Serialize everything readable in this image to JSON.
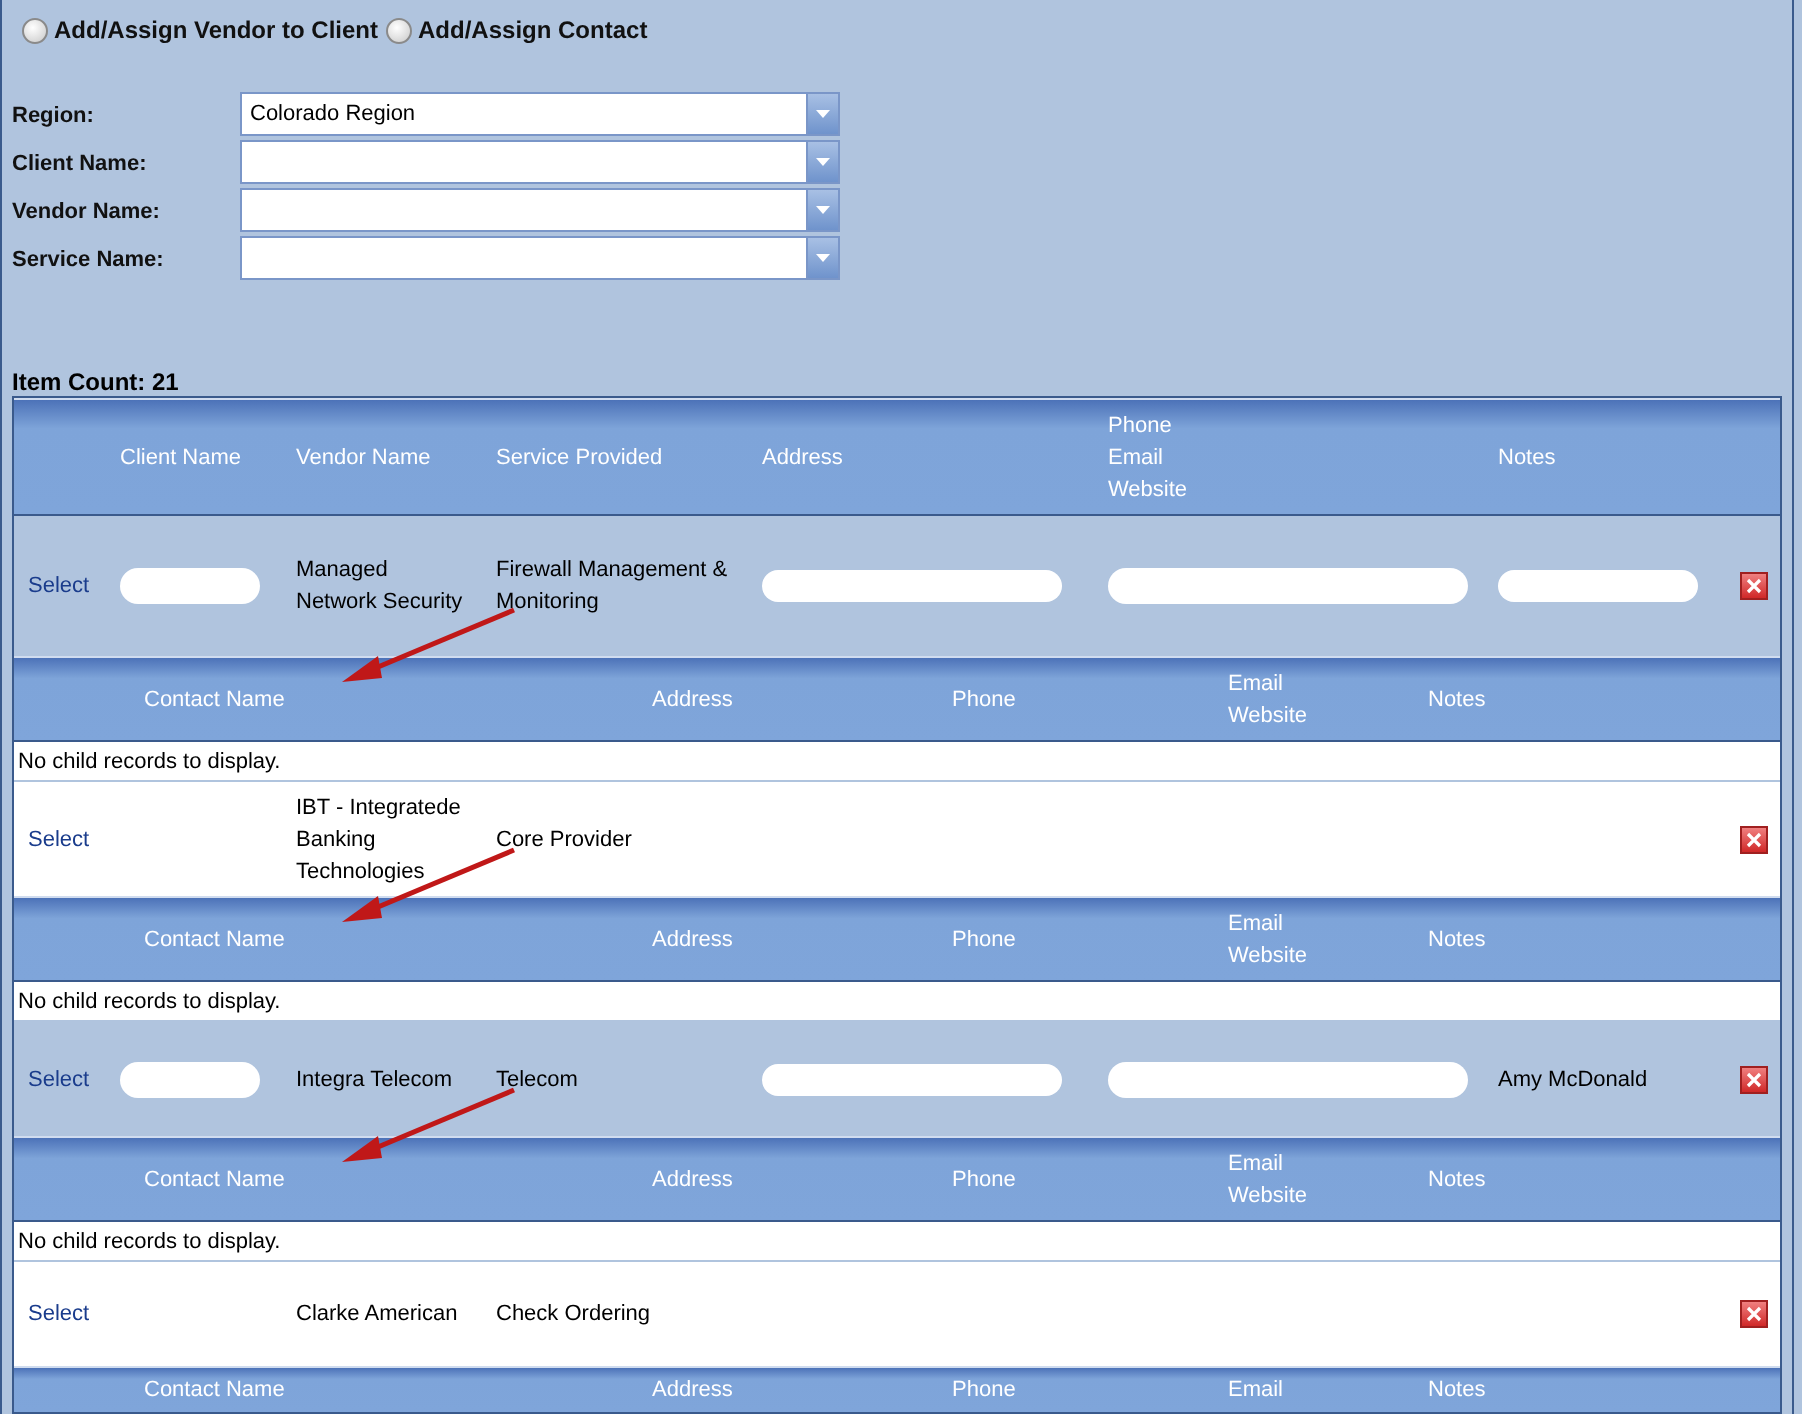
{
  "options": [
    {
      "label": "Add/Assign Vendor to Client",
      "selected": false
    },
    {
      "label": "Add/Assign Contact",
      "selected": false
    }
  ],
  "filters": [
    {
      "label": "Region:",
      "value": "Colorado Region"
    },
    {
      "label": "Client Name:"
    },
    {
      "label": "Vendor Name:"
    },
    {
      "label": "Service Name:"
    }
  ],
  "item_count": "Item Count: 21",
  "columns": [
    "Client Name",
    "Vendor Name",
    "Service Provided",
    "Address",
    "Phone\nEmail\nWebsite",
    "Notes"
  ],
  "rows": [
    {
      "action": "Select",
      "vendor": "Managed\nNetwork Security",
      "service": "Firewall Management &\nMonitoring",
      "redacted": true,
      "child": {
        "arrow": true,
        "columns": [
          "Contact Name",
          "Address",
          "Phone",
          "Email\nWebsite",
          "Notes"
        ],
        "empty_text": "No child records to display."
      }
    },
    {
      "action": "Select",
      "vendor": "IBT - Integratede\nBanking\nTechnologies",
      "service": "Core Provider",
      "redacted": false,
      "child": {
        "arrow": true,
        "columns": [
          "Contact Name",
          "Address",
          "Phone",
          "Email\nWebsite",
          "Notes"
        ],
        "empty_text": "No child records to display."
      }
    },
    {
      "action": "Select",
      "vendor": "Integra Telecom",
      "service": "Telecom",
      "notes": "Amy McDonald",
      "redacted": true,
      "child": {
        "arrow": true,
        "columns": [
          "Contact Name",
          "Address",
          "Phone",
          "Email\nWebsite",
          "Notes"
        ],
        "empty_text": "No child records to display."
      }
    },
    {
      "action": "Select",
      "vendor": "Clarke American",
      "service": "Check Ordering",
      "redacted": false,
      "child": {
        "arrow": false,
        "columns": [
          "Contact Name",
          "Address",
          "Phone",
          "Email",
          "Notes"
        ]
      }
    }
  ]
}
